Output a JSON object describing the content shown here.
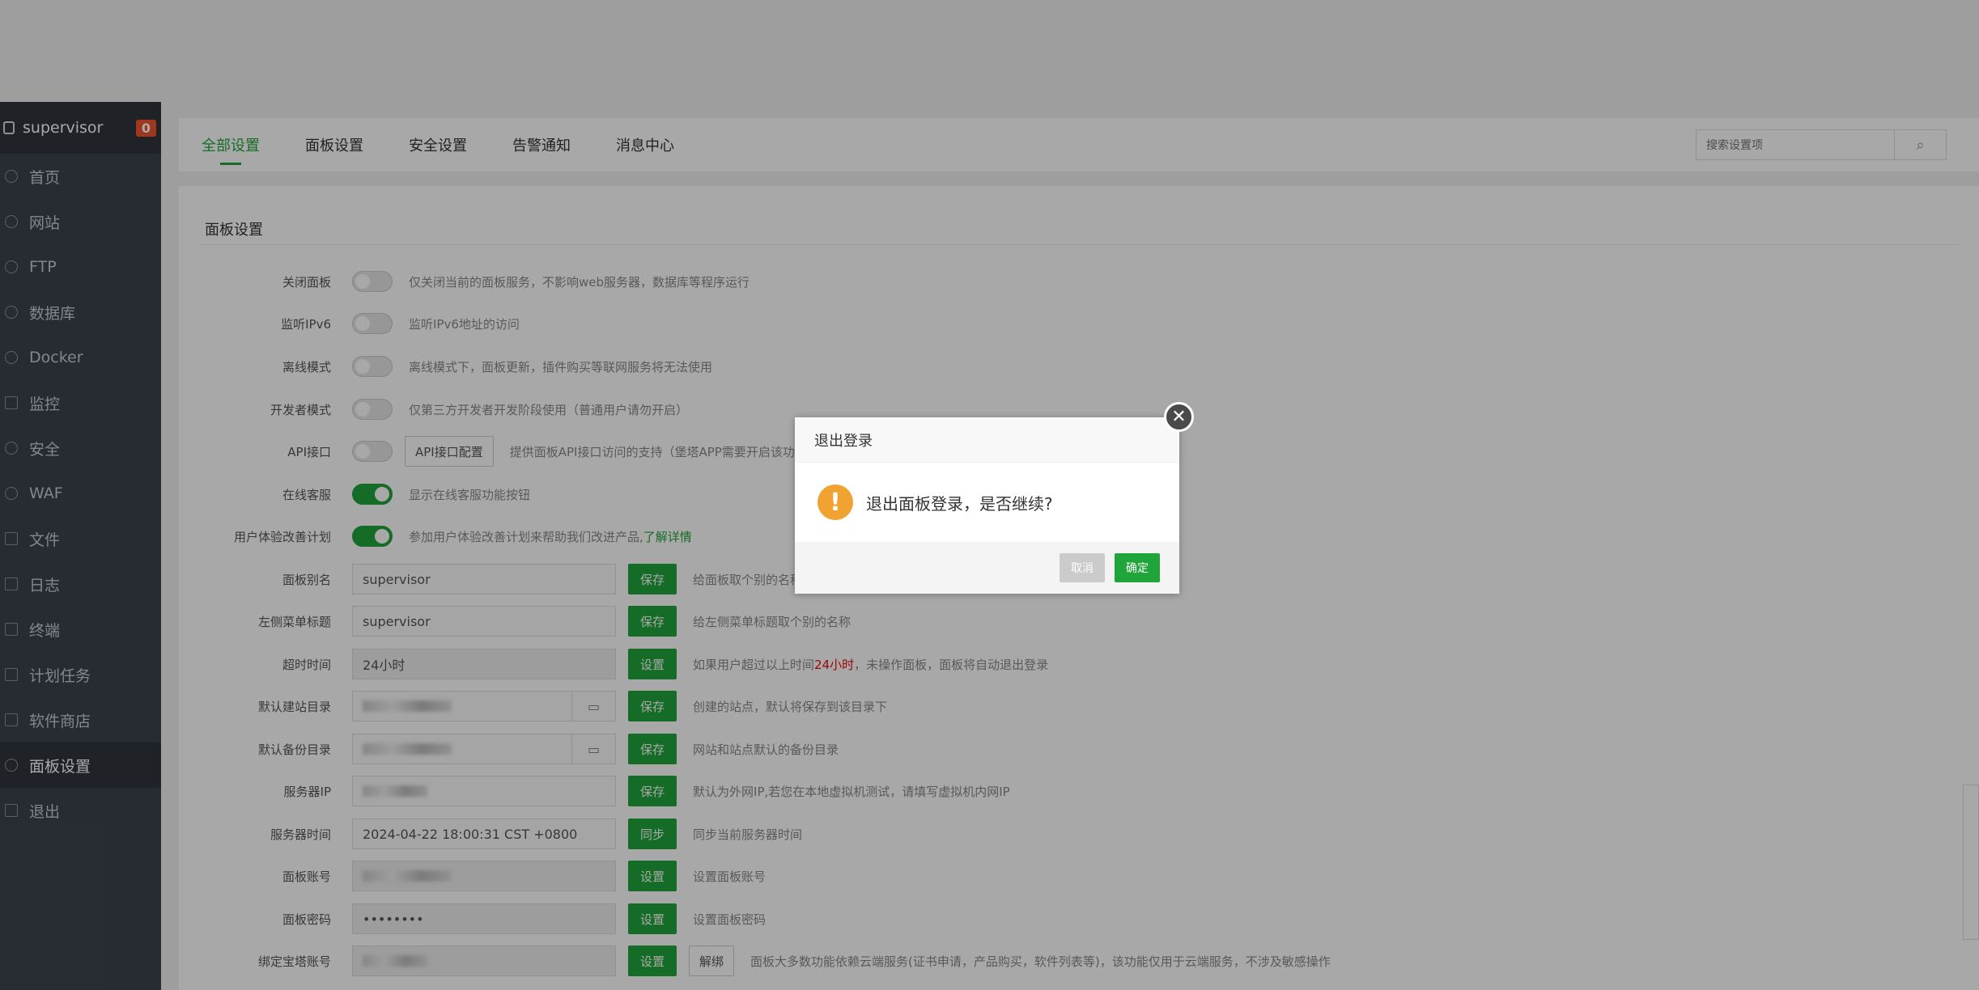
{
  "sidebar": {
    "title": "supervisor",
    "badge": "0",
    "items": [
      {
        "label": "首页",
        "icon": "home-icon"
      },
      {
        "label": "网站",
        "icon": "globe-icon"
      },
      {
        "label": "FTP",
        "icon": "ftp-icon"
      },
      {
        "label": "数据库",
        "icon": "database-icon"
      },
      {
        "label": "Docker",
        "icon": "docker-icon"
      },
      {
        "label": "监控",
        "icon": "monitor-icon"
      },
      {
        "label": "安全",
        "icon": "shield-icon"
      },
      {
        "label": "WAF",
        "icon": "waf-icon"
      },
      {
        "label": "文件",
        "icon": "folder-icon"
      },
      {
        "label": "日志",
        "icon": "log-icon"
      },
      {
        "label": "终端",
        "icon": "terminal-icon"
      },
      {
        "label": "计划任务",
        "icon": "calendar-icon"
      },
      {
        "label": "软件商店",
        "icon": "grid-icon"
      },
      {
        "label": "面板设置",
        "icon": "gear-icon"
      },
      {
        "label": "退出",
        "icon": "logout-icon"
      }
    ]
  },
  "tabs": [
    "全部设置",
    "面板设置",
    "安全设置",
    "告警通知",
    "消息中心"
  ],
  "search": {
    "placeholder": "搜索设置项"
  },
  "panel": {
    "title": "面板设置",
    "rows": {
      "close_panel": {
        "label": "关闭面板",
        "desc": "仅关闭当前的面板服务，不影响web服务器，数据库等程序运行"
      },
      "ipv6": {
        "label": "监听IPv6",
        "desc": "监听IPv6地址的访问"
      },
      "offline": {
        "label": "离线模式",
        "desc": "离线模式下，面板更新，插件购买等联网服务将无法使用"
      },
      "dev": {
        "label": "开发者模式",
        "desc": "仅第三方开发者开发阶段使用（普通用户请勿开启）"
      },
      "api": {
        "label": "API接口",
        "btn": "API接口配置",
        "desc": "提供面板API接口访问的支持（堡塔APP需要开启该功能）"
      },
      "online_service": {
        "label": "在线客服",
        "desc": "显示在线客服功能按钮"
      },
      "ux": {
        "label": "用户体验改善计划",
        "desc": "参加用户体验改善计划来帮助我们改进产品,",
        "link": "了解详情"
      },
      "alias": {
        "label": "面板别名",
        "value": "supervisor",
        "btn": "保存",
        "desc": "给面板取个别的名称"
      },
      "menu_title": {
        "label": "左侧菜单标题",
        "value": "supervisor",
        "btn": "保存",
        "desc": "给左侧菜单标题取个别的名称"
      },
      "timeout": {
        "label": "超时时间",
        "value": "24小时",
        "btn": "设置",
        "desc_a": "如果用户超过以上时间",
        "desc_red": "24小时",
        "desc_b": "，未操作面板，面板将自动退出登录"
      },
      "site_dir": {
        "label": "默认建站目录",
        "btn": "保存",
        "desc": "创建的站点，默认将保存到该目录下"
      },
      "backup_dir": {
        "label": "默认备份目录",
        "btn": "保存",
        "desc": "网站和站点默认的备份目录"
      },
      "server_ip": {
        "label": "服务器IP",
        "btn": "保存",
        "desc": "默认为外网IP,若您在本地虚拟机测试，请填写虚拟机内网IP"
      },
      "server_time": {
        "label": "服务器时间",
        "value": "2024-04-22 18:00:31 CST +0800",
        "btn": "同步",
        "desc": "同步当前服务器时间"
      },
      "account": {
        "label": "面板账号",
        "btn": "设置",
        "desc": "设置面板账号"
      },
      "password": {
        "label": "面板密码",
        "value": "••••••••",
        "btn": "设置",
        "desc": "设置面板密码"
      },
      "bt_account": {
        "label": "绑定宝塔账号",
        "btn": "设置",
        "btn2": "解绑",
        "desc": "面板大多数功能依赖云端服务(证书申请，产品购买，软件列表等)，该功能仅用于云端服务，不涉及敏感操作"
      }
    }
  },
  "dialog": {
    "title": "退出登录",
    "message": "退出面板登录，是否继续?",
    "cancel": "取消",
    "confirm": "确定"
  },
  "colors": {
    "accent": "#20a53a",
    "sidebar": "#3c444d",
    "warning": "#f0a330",
    "badge": "#f0542d"
  }
}
